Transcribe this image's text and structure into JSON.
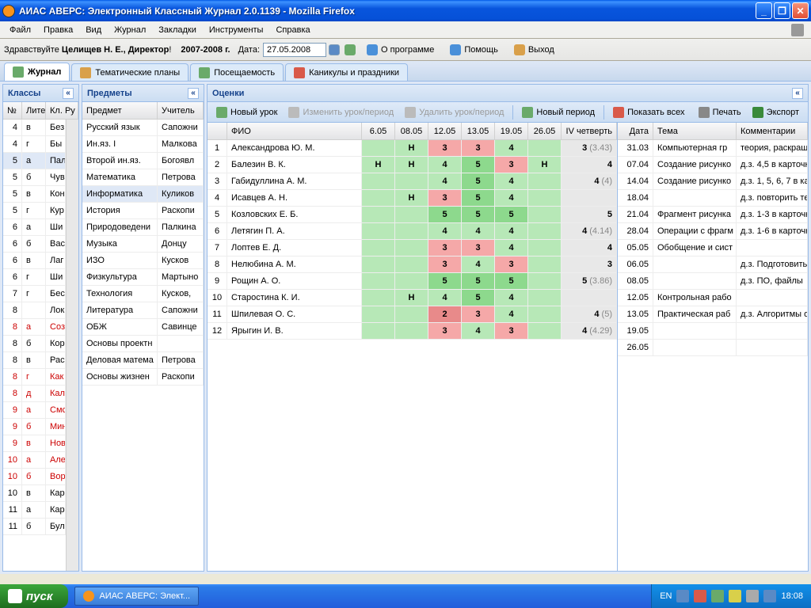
{
  "window": {
    "title": "АИАС АВЕРС: Электронный Классный Журнал 2.0.1139 - Mozilla Firefox"
  },
  "menubar": {
    "file": "Файл",
    "edit": "Правка",
    "view": "Вид",
    "journal": "Журнал",
    "bookmarks": "Закладки",
    "tools": "Инструменты",
    "help": "Справка"
  },
  "toolbar": {
    "greeting_label": "Здравствуйте",
    "user": "Целищев Н. Е., Директор",
    "year": "2007-2008 г.",
    "date_label": "Дата:",
    "date_value": "27.05.2008",
    "about": "О программе",
    "help": "Помощь",
    "exit": "Выход"
  },
  "tabs": {
    "journal": "Журнал",
    "plans": "Тематические планы",
    "attendance": "Посещаемость",
    "holidays": "Каникулы и праздники"
  },
  "panels": {
    "classes": "Классы",
    "subjects": "Предметы",
    "grades": "Оценки"
  },
  "classes": {
    "headers": {
      "no": "№",
      "lit": "Лите",
      "teacher": "Кл. Ру"
    },
    "rows": [
      {
        "no": "4",
        "lit": "в",
        "t": "Без"
      },
      {
        "no": "4",
        "lit": "г",
        "t": "Бы"
      },
      {
        "no": "5",
        "lit": "а",
        "t": "Пал",
        "sel": true
      },
      {
        "no": "5",
        "lit": "б",
        "t": "Чув"
      },
      {
        "no": "5",
        "lit": "в",
        "t": "Кон"
      },
      {
        "no": "5",
        "lit": "г",
        "t": "Кур"
      },
      {
        "no": "6",
        "lit": "а",
        "t": "Ши"
      },
      {
        "no": "6",
        "lit": "б",
        "t": "Вас"
      },
      {
        "no": "6",
        "lit": "в",
        "t": "Лаг"
      },
      {
        "no": "6",
        "lit": "г",
        "t": "Ши"
      },
      {
        "no": "7",
        "lit": "г",
        "t": "Бес"
      },
      {
        "no": "8",
        "lit": "",
        "t": "Лок"
      },
      {
        "no": "8",
        "lit": "а",
        "t": "Соз",
        "red": true
      },
      {
        "no": "8",
        "lit": "б",
        "t": "Кор"
      },
      {
        "no": "8",
        "lit": "в",
        "t": "Рас"
      },
      {
        "no": "8",
        "lit": "г",
        "t": "Как",
        "red": true
      },
      {
        "no": "8",
        "lit": "д",
        "t": "Кал",
        "red": true
      },
      {
        "no": "9",
        "lit": "а",
        "t": "Смс",
        "red": true
      },
      {
        "no": "9",
        "lit": "б",
        "t": "Мин",
        "red": true
      },
      {
        "no": "9",
        "lit": "в",
        "t": "Нов",
        "red": true
      },
      {
        "no": "10",
        "lit": "а",
        "t": "Але",
        "red": true
      },
      {
        "no": "10",
        "lit": "б",
        "t": "Вор",
        "red": true
      },
      {
        "no": "10",
        "lit": "в",
        "t": "Кар"
      },
      {
        "no": "11",
        "lit": "а",
        "t": "Кар"
      },
      {
        "no": "11",
        "lit": "б",
        "t": "Бул"
      }
    ]
  },
  "subjects": {
    "headers": {
      "subject": "Предмет",
      "teacher": "Учитель"
    },
    "rows": [
      {
        "s": "Русский язык",
        "t": "Сапожни"
      },
      {
        "s": "Ин.яз. I",
        "t": "Малкова"
      },
      {
        "s": "Второй ин.яз.",
        "t": "Богоявл"
      },
      {
        "s": "Математика",
        "t": "Петрова"
      },
      {
        "s": "Информатика",
        "t": "Куликов",
        "sel": true
      },
      {
        "s": "История",
        "t": "Раскопи"
      },
      {
        "s": "Природоведени",
        "t": "Палкина"
      },
      {
        "s": "Музыка",
        "t": "Донцу"
      },
      {
        "s": "ИЗО",
        "t": "Кусков"
      },
      {
        "s": "Физкультура",
        "t": "Мартыно"
      },
      {
        "s": "Технология",
        "t": "Кусков,"
      },
      {
        "s": "Литература",
        "t": "Сапожни"
      },
      {
        "s": "ОБЖ",
        "t": "Савинце"
      },
      {
        "s": "Основы проектн",
        "t": ""
      },
      {
        "s": "Деловая матема",
        "t": "Петрова"
      },
      {
        "s": "Основы жизнен",
        "t": "Раскопи"
      }
    ]
  },
  "grades_toolbar": {
    "new_lesson": "Новый урок",
    "edit_lesson": "Изменить урок/период",
    "delete_lesson": "Удалить урок/период",
    "new_period": "Новый период",
    "show_all": "Показать всех",
    "print": "Печать",
    "export": "Экспорт"
  },
  "grades": {
    "headers": {
      "fio": "ФИО",
      "dates": [
        "6.05",
        "08.05",
        "12.05",
        "13.05",
        "19.05",
        "26.05"
      ],
      "quarter": "IV четверть"
    },
    "rows": [
      {
        "n": 1,
        "fio": "Александрова Ю. М.",
        "c": [
          "",
          "Н",
          "3",
          "3",
          "4",
          ""
        ],
        "q": "3 (3.43)"
      },
      {
        "n": 2,
        "fio": "Балезин В. К.",
        "c": [
          "Н",
          "Н",
          "4",
          "5",
          "3",
          "Н"
        ],
        "q": "4"
      },
      {
        "n": 3,
        "fio": "Габидуллина А. М.",
        "c": [
          "",
          "",
          "4",
          "5",
          "4",
          ""
        ],
        "q": "4 (4)"
      },
      {
        "n": 4,
        "fio": "Исавцев А. Н.",
        "c": [
          "",
          "Н",
          "3",
          "5",
          "4",
          ""
        ],
        "q": ""
      },
      {
        "n": 5,
        "fio": "Козловских Е. Б.",
        "c": [
          "",
          "",
          "5",
          "5",
          "5",
          ""
        ],
        "q": "5"
      },
      {
        "n": 6,
        "fio": "Летягин П. А.",
        "c": [
          "",
          "",
          "4",
          "4",
          "4",
          ""
        ],
        "q": "4 (4.14)"
      },
      {
        "n": 7,
        "fio": "Лоптев Е. Д.",
        "c": [
          "",
          "",
          "3",
          "3",
          "4",
          ""
        ],
        "q": "4"
      },
      {
        "n": 8,
        "fio": "Нелюбина А. М.",
        "c": [
          "",
          "",
          "3",
          "4",
          "3",
          ""
        ],
        "q": "3"
      },
      {
        "n": 9,
        "fio": "Рощин А. О.",
        "c": [
          "",
          "",
          "5",
          "5",
          "5",
          ""
        ],
        "q": "5 (3.86)"
      },
      {
        "n": 10,
        "fio": "Старостина К. И.",
        "c": [
          "",
          "Н",
          "4",
          "5",
          "4",
          ""
        ],
        "q": ""
      },
      {
        "n": 11,
        "fio": "Шпилевая О. С.",
        "c": [
          "",
          "",
          "2",
          "3",
          "4",
          ""
        ],
        "q": "4 (5)"
      },
      {
        "n": 12,
        "fio": "Ярыгин И. В.",
        "c": [
          "",
          "",
          "3",
          "4",
          "3",
          ""
        ],
        "q": "4 (4.29)"
      }
    ]
  },
  "lessons": {
    "headers": {
      "date": "Дата",
      "topic": "Тема",
      "comment": "Комментарии"
    },
    "rows": [
      {
        "d": "31.03",
        "t": "Компьютерная гр",
        "c": "теория, раскраши"
      },
      {
        "d": "07.04",
        "t": "Создание рисунко",
        "c": "д.з. 4,5 в карточк"
      },
      {
        "d": "14.04",
        "t": "Создание рисунко",
        "c": "д.з. 1, 5, 6, 7 в ка"
      },
      {
        "d": "18.04",
        "t": "",
        "c": "д.з. повторить те"
      },
      {
        "d": "21.04",
        "t": "Фрагмент рисунка",
        "c": "д.з. 1-3 в карточк"
      },
      {
        "d": "28.04",
        "t": "Операции с фрагм",
        "c": "д.з. 1-6 в карточк"
      },
      {
        "d": "05.05",
        "t": "Обобщение и сист",
        "c": ""
      },
      {
        "d": "06.05",
        "t": "",
        "c": "д.з. Подготовить"
      },
      {
        "d": "08.05",
        "t": "",
        "c": "д.з. ПО, файлы"
      },
      {
        "d": "12.05",
        "t": "Контрольная рабо",
        "c": ""
      },
      {
        "d": "13.05",
        "t": "Практическая раб",
        "c": "д.з. Алгоритмы оп"
      },
      {
        "d": "19.05",
        "t": "",
        "c": ""
      },
      {
        "d": "26.05",
        "t": "",
        "c": ""
      }
    ]
  },
  "taskbar": {
    "start": "пуск",
    "task": "АИАС АВЕРС: Элект...",
    "lang": "EN",
    "time": "18:08"
  }
}
